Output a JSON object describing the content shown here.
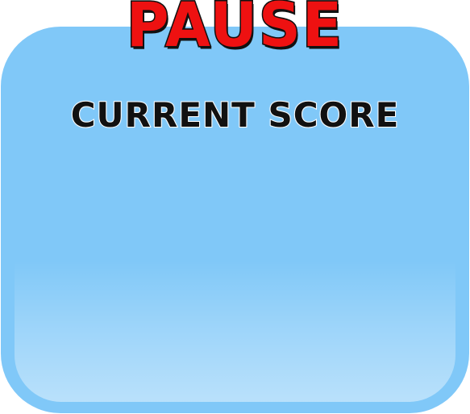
{
  "pause_panel": {
    "title": "PAUSE",
    "score_label": "CURRENT SCORE",
    "colors": {
      "panel": "#80c8f8",
      "title_fill": "#ee1111",
      "outline": "#111111"
    }
  }
}
